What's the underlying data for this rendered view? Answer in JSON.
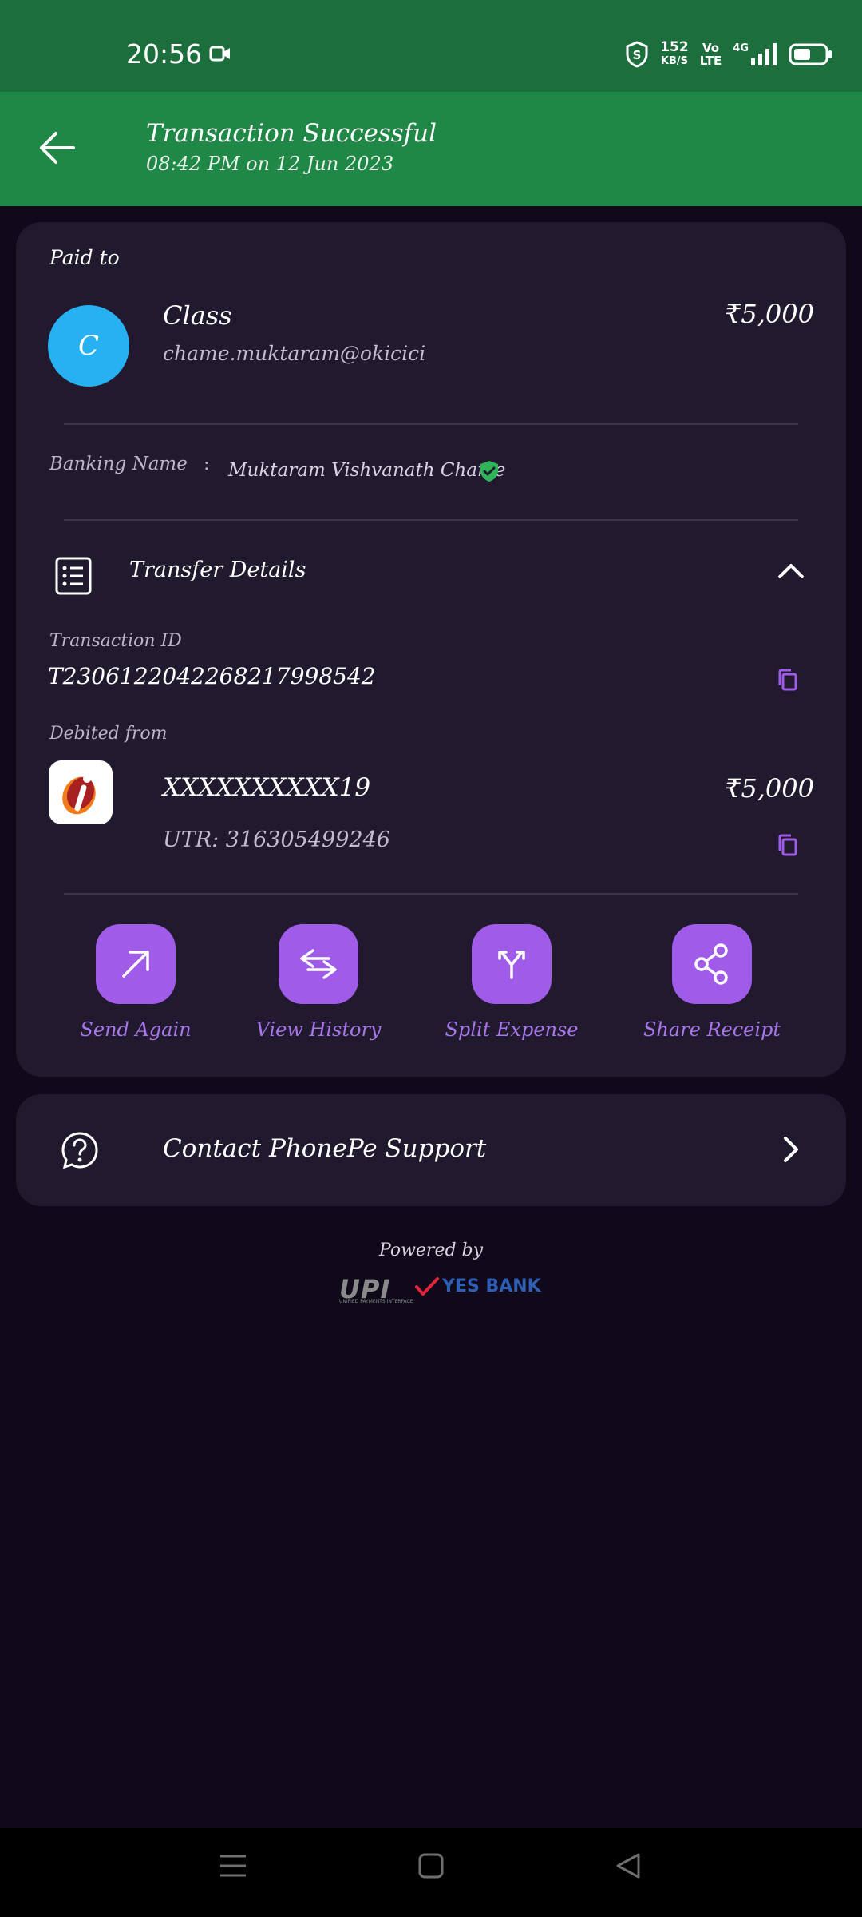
{
  "status": {
    "time": "20:56",
    "speed_value": "152",
    "speed_unit": "KB/S",
    "volte_top": "Vo",
    "volte_bottom": "LTE",
    "network": "4G"
  },
  "header": {
    "title": "Transaction Successful",
    "subtitle": "08:42 PM on 12 Jun 2023"
  },
  "payment": {
    "paid_to_label": "Paid to",
    "avatar_initial": "C",
    "payee_name": "Class",
    "payee_upi": "chame.muktaram@okicici",
    "amount": "₹5,000",
    "banking_name_label": "Banking Name",
    "banking_name_sep": ":",
    "banking_name": "Muktaram Vishvanath Chame"
  },
  "transfer": {
    "title": "Transfer Details",
    "txn_id_label": "Transaction ID",
    "txn_id": "T2306122042268217998542",
    "debited_label": "Debited from",
    "account": "XXXXXXXXXX19",
    "amount": "₹5,000",
    "utr": "UTR: 316305499246"
  },
  "actions": [
    {
      "label": "Send Again",
      "icon": "arrow-up-right-icon"
    },
    {
      "label": "View History",
      "icon": "swap-arrows-icon"
    },
    {
      "label": "Split Expense",
      "icon": "split-icon"
    },
    {
      "label": "Share Receipt",
      "icon": "share-icon"
    }
  ],
  "support": {
    "label": "Contact PhonePe Support"
  },
  "footer": {
    "powered_by": "Powered by",
    "upi_text": "UPI",
    "upi_sub": "UNIFIED PAYMENTS INTERFACE",
    "bank_text": "YES BANK"
  },
  "colors": {
    "status_bg": "#1c6e3c",
    "header_bg": "#208847",
    "page_bg": "#0f0919",
    "card_bg": "#211a2e",
    "accent": "#a05be8",
    "avatar": "#27b1f3",
    "verified": "#2fb45a"
  }
}
